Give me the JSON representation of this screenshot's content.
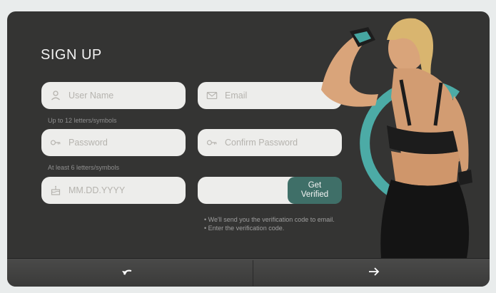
{
  "signup": {
    "title": "SIGN UP",
    "username": {
      "placeholder": "User Name",
      "icon": "user-icon",
      "hint": "Up to 12 letters/symbols"
    },
    "email": {
      "placeholder": "Email",
      "icon": "mail-icon"
    },
    "password": {
      "placeholder": "Password",
      "icon": "key-icon",
      "hint": "At least 6 letters/symbols"
    },
    "confirm_password": {
      "placeholder": "Confirm Password",
      "icon": "key-icon"
    },
    "birthday": {
      "placeholder": "MM.DD.YYYY",
      "icon": "cake-icon"
    },
    "verification_code": {
      "placeholder": ""
    },
    "verify_button": "Get Verified",
    "notes": [
      "• We'll send you the verification code to email.",
      "• Enter the verification code."
    ]
  },
  "footer": {
    "back_icon": "undo-arrow-icon",
    "next_icon": "right-arrow-icon"
  },
  "colors": {
    "panel": "#343433",
    "field": "#ededeb",
    "accent": "#3f6f68",
    "ring": "#4fb8b2"
  }
}
